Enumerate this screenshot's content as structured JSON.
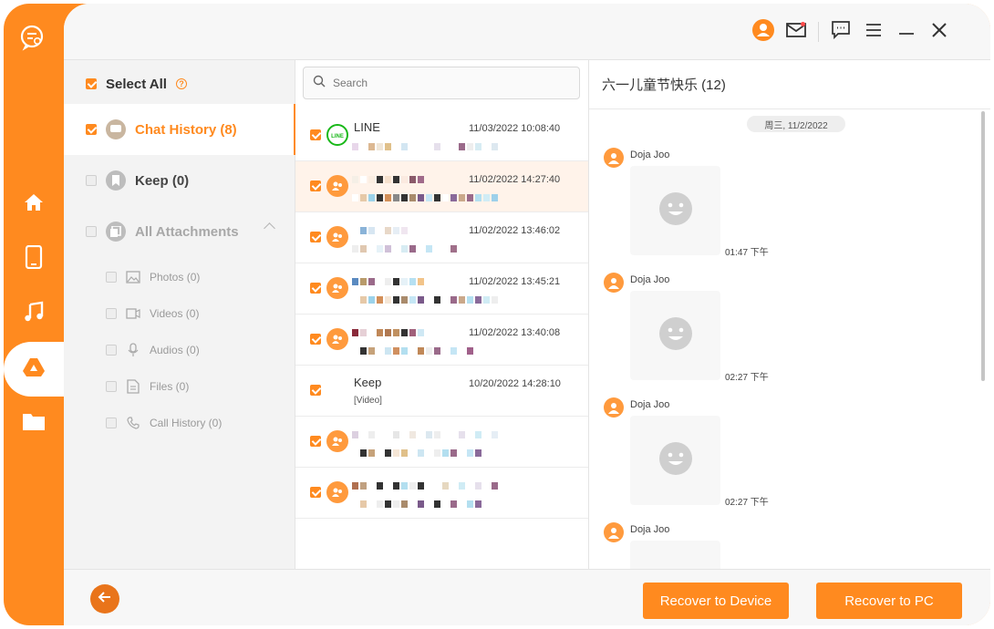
{
  "colors": {
    "accent": "#ff8a1f",
    "accent_dark": "#e9741a",
    "line_green": "#19b819"
  },
  "rail": {
    "items": [
      {
        "name": "home-icon",
        "active": false
      },
      {
        "name": "phone-icon",
        "active": false
      },
      {
        "name": "music-icon",
        "active": false
      },
      {
        "name": "drive-icon",
        "active": true
      },
      {
        "name": "folder-icon",
        "active": false
      }
    ]
  },
  "toolbar": {
    "icons": [
      "user-icon",
      "mail-icon",
      "feedback-icon",
      "menu-icon",
      "minimize-icon",
      "close-icon"
    ]
  },
  "categories": {
    "select_all": "Select All",
    "chat_history": "Chat History (8)",
    "keep": "Keep (0)",
    "all_attachments": "All Attachments",
    "sub": {
      "photos": "Photos (0)",
      "videos": "Videos (0)",
      "audios": "Audios (0)",
      "files": "Files (0)",
      "call_history": "Call History (0)"
    }
  },
  "search": {
    "placeholder": "Search"
  },
  "messages": [
    {
      "name": "LINE",
      "time": "11/03/2022 10:08:40",
      "preview": ""
    },
    {
      "name": "",
      "time": "11/02/2022 14:27:40",
      "preview": ""
    },
    {
      "name": "",
      "time": "11/02/2022 13:46:02",
      "preview": ""
    },
    {
      "name": "",
      "time": "11/02/2022 13:45:21",
      "preview": ""
    },
    {
      "name": "",
      "time": "11/02/2022 13:40:08",
      "preview": ""
    },
    {
      "name": "Keep",
      "time": "10/20/2022 14:28:10",
      "preview": "[Video]"
    },
    {
      "name": "",
      "time": "",
      "preview": ""
    },
    {
      "name": "",
      "time": "",
      "preview": ""
    }
  ],
  "chat": {
    "title": "六一儿童节快乐 (12)",
    "date": "周三, 11/2/2022",
    "entries": [
      {
        "sender": "Doja Joo",
        "time": "01:47 下午"
      },
      {
        "sender": "Doja Joo",
        "time": "02:27 下午"
      },
      {
        "sender": "Doja Joo",
        "time": "02:27 下午"
      },
      {
        "sender": "Doja Joo",
        "time": ""
      }
    ]
  },
  "footer": {
    "recover_device": "Recover to Device",
    "recover_pc": "Recover to PC"
  }
}
